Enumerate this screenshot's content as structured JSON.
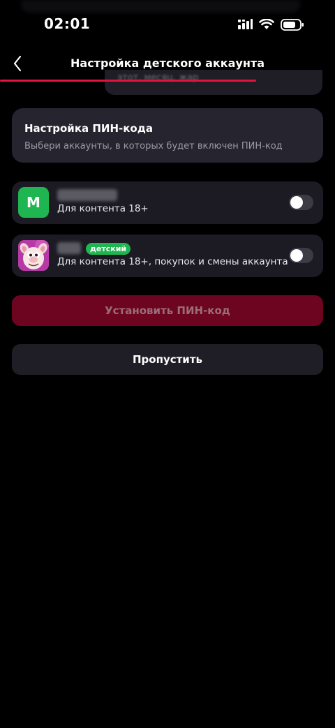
{
  "status_bar": {
    "time": "02:01",
    "icons": [
      "signal-icon",
      "wifi-icon",
      "battery-icon"
    ]
  },
  "header": {
    "title": "Настройка детского аккаунта",
    "back_icon": "chevron-left-icon",
    "accent_color": "#e3143b"
  },
  "peek_card": {
    "text": "этот, месяц, жар"
  },
  "pin_settings": {
    "title": "Настройка ПИН-кода",
    "subtitle": "Выбери аккаунты, в которых будет включен ПИН-код"
  },
  "accounts": [
    {
      "avatar_letter": "M",
      "avatar_color": "#1fb550",
      "name": "",
      "description": "Для контента 18+",
      "toggle_on": false
    },
    {
      "avatar_icon": "kid-character-avatar",
      "avatar_color": "#b63aa6",
      "name": "",
      "badge": "детский",
      "badge_color": "#1fb550",
      "description": "Для контента 18+, покупок и смены аккаунта",
      "toggle_on": false
    }
  ],
  "actions": {
    "set_pin_label": "Установить ПИН-код",
    "skip_label": "Пропустить"
  }
}
